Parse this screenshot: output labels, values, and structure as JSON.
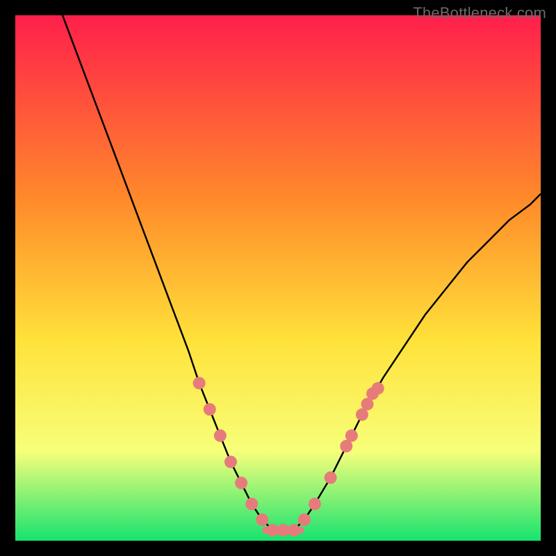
{
  "watermark": "TheBottleneck.com",
  "chart_data": {
    "type": "line",
    "title": "",
    "xlabel": "",
    "ylabel": "",
    "xlim": [
      0,
      100
    ],
    "ylim": [
      0,
      100
    ],
    "gradient_colors": {
      "top": "#ff1f4b",
      "mid_upper": "#ff8a2a",
      "mid": "#ffe23a",
      "mid_lower": "#f7ff7a",
      "bottom": "#16e36f"
    },
    "series": [
      {
        "name": "bottleneck-curve",
        "x": [
          9,
          12,
          15,
          18,
          21,
          24,
          27,
          30,
          33,
          35,
          37,
          39,
          41,
          43,
          45,
          47,
          49,
          51,
          53,
          55,
          57,
          60,
          63,
          66,
          70,
          74,
          78,
          82,
          86,
          90,
          94,
          98,
          100
        ],
        "y": [
          100,
          92,
          84,
          76,
          68,
          60,
          52,
          44,
          36,
          30,
          25,
          20,
          15,
          11,
          7,
          4,
          2,
          2,
          2,
          4,
          7,
          12,
          18,
          24,
          31,
          37,
          43,
          48,
          53,
          57,
          61,
          64,
          66
        ]
      }
    ],
    "markers": {
      "name": "highlight-dots",
      "color": "#e77b7b",
      "radius": 9,
      "points": [
        {
          "x": 35,
          "y": 30
        },
        {
          "x": 37,
          "y": 25
        },
        {
          "x": 39,
          "y": 20
        },
        {
          "x": 41,
          "y": 15
        },
        {
          "x": 43,
          "y": 11
        },
        {
          "x": 45,
          "y": 7
        },
        {
          "x": 47,
          "y": 4
        },
        {
          "x": 49,
          "y": 2
        },
        {
          "x": 51,
          "y": 2
        },
        {
          "x": 53,
          "y": 2
        },
        {
          "x": 55,
          "y": 4
        },
        {
          "x": 57,
          "y": 7
        },
        {
          "x": 60,
          "y": 12
        },
        {
          "x": 63,
          "y": 18
        },
        {
          "x": 64,
          "y": 20
        },
        {
          "x": 66,
          "y": 24
        },
        {
          "x": 67,
          "y": 26
        },
        {
          "x": 68,
          "y": 28
        },
        {
          "x": 69,
          "y": 29
        }
      ]
    },
    "flat_bottom": {
      "x_start": 47,
      "x_end": 55,
      "y": 2,
      "thickness": 10,
      "color": "#e77b7b"
    }
  }
}
